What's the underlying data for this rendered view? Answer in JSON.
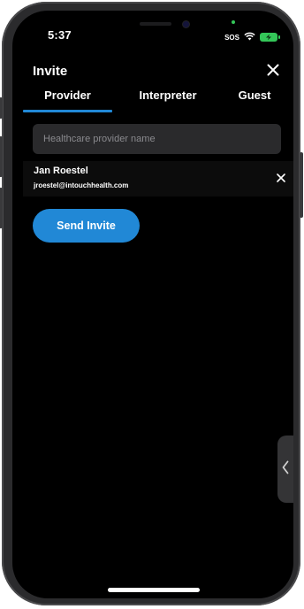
{
  "status_bar": {
    "time": "5:37",
    "sos": "SOS",
    "wifi_icon": "wifi-icon",
    "battery_icon": "battery-charging-icon"
  },
  "header": {
    "title": "Invite",
    "close_icon": "close-icon"
  },
  "tabs": [
    {
      "label": "Provider",
      "active": true
    },
    {
      "label": "Interpreter",
      "active": false
    },
    {
      "label": "Guest",
      "active": false
    }
  ],
  "search": {
    "placeholder": "Healthcare provider name",
    "value": ""
  },
  "selected_user": {
    "name": "Jan Roestel",
    "email": "jroestel@intouchhealth.com",
    "remove_icon": "close-icon"
  },
  "actions": {
    "send_invite_label": "Send Invite"
  },
  "drawer": {
    "handle_icon": "chevron-left-icon"
  },
  "colors": {
    "accent": "#2188d6",
    "background": "#000000",
    "input_background": "#2a2a2c",
    "battery": "#34c759"
  }
}
